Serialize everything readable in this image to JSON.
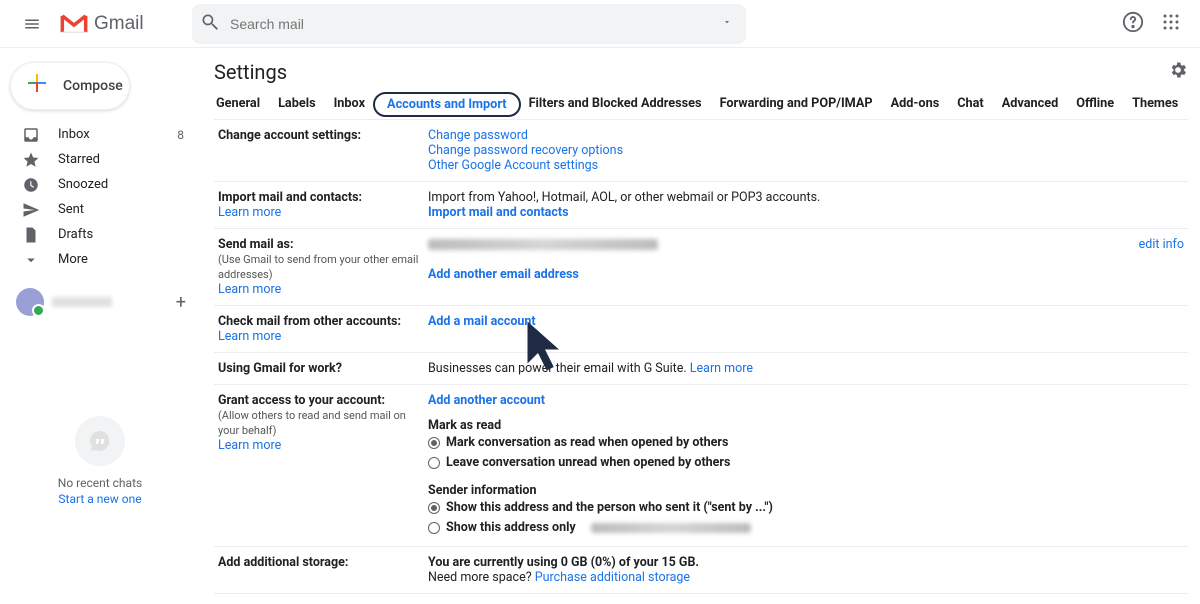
{
  "header": {
    "brand": "Gmail",
    "search_placeholder": "Search mail"
  },
  "sidebar": {
    "compose": "Compose",
    "items": [
      {
        "label": "Inbox",
        "count": "8",
        "icon": "inbox"
      },
      {
        "label": "Starred",
        "icon": "star"
      },
      {
        "label": "Snoozed",
        "icon": "clock"
      },
      {
        "label": "Sent",
        "icon": "send"
      },
      {
        "label": "Drafts",
        "icon": "file"
      },
      {
        "label": "More",
        "icon": "chevron"
      }
    ],
    "hangouts_empty": "No recent chats",
    "hangouts_start": "Start a new one"
  },
  "settings": {
    "title": "Settings",
    "tabs": [
      "General",
      "Labels",
      "Inbox",
      "Accounts and Import",
      "Filters and Blocked Addresses",
      "Forwarding and POP/IMAP",
      "Add-ons",
      "Chat",
      "Advanced",
      "Offline",
      "Themes"
    ],
    "rows": {
      "change_account": {
        "label": "Change account settings:",
        "links": [
          "Change password",
          "Change password recovery options",
          "Other Google Account settings"
        ]
      },
      "import_mail": {
        "label": "Import mail and contacts:",
        "learn": "Learn more",
        "desc": "Import from Yahoo!, Hotmail, AOL, or other webmail or POP3 accounts.",
        "action": "Import mail and contacts"
      },
      "send_as": {
        "label": "Send mail as:",
        "sub": "(Use Gmail to send from your other email addresses)",
        "learn": "Learn more",
        "action": "Add another email address",
        "edit": "edit info"
      },
      "check_mail": {
        "label": "Check mail from other accounts:",
        "learn": "Learn more",
        "action": "Add a mail account"
      },
      "work": {
        "label": "Using Gmail for work?",
        "desc_pre": "Businesses can power their email with G Suite. ",
        "desc_link": "Learn more"
      },
      "grant": {
        "label": "Grant access to your account:",
        "sub": "(Allow others to read and send mail on your behalf)",
        "learn": "Learn more",
        "action": "Add another account",
        "mark_heading": "Mark as read",
        "mark_opt1": "Mark conversation as read when opened by others",
        "mark_opt2": "Leave conversation unread when opened by others",
        "sender_heading": "Sender information",
        "sender_opt1": "Show this address and the person who sent it (\"sent by ...\")",
        "sender_opt2": "Show this address only"
      },
      "storage": {
        "label": "Add additional storage:",
        "desc_bold": "You are currently using 0 GB (0%) of your 15 GB.",
        "desc_pre": "Need more space? ",
        "desc_link": "Purchase additional storage"
      }
    }
  }
}
